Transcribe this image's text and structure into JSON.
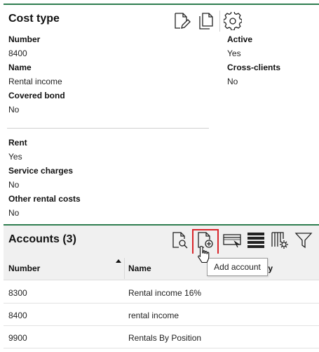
{
  "cost_type": {
    "title": "Cost type",
    "fields": [
      {
        "label": "Number",
        "value": "8400"
      },
      {
        "label": "Name",
        "value": "Rental income"
      },
      {
        "label": "Covered bond",
        "value": "No"
      },
      {
        "label": "Active",
        "value": "Yes"
      },
      {
        "label": "Cross-clients",
        "value": "No"
      },
      {
        "label": "Rent",
        "value": "Yes"
      },
      {
        "label": "Service charges",
        "value": "No"
      },
      {
        "label": "Other rental costs",
        "value": "No"
      }
    ],
    "toolbar_icons": [
      "edit-document-icon",
      "copy-document-icon",
      "settings-gear-icon"
    ]
  },
  "accounts": {
    "title": "Accounts (3)",
    "toolbar_icons": [
      "view-document-icon",
      "add-account-icon",
      "card-icon",
      "table-rows-icon",
      "column-settings-icon",
      "filter-icon"
    ],
    "columns": [
      "Number",
      "Name",
      "ity"
    ],
    "sort_column": "Number",
    "sort_direction": "ascending",
    "rows": [
      {
        "number": "8300",
        "name": "Rental income 16%"
      },
      {
        "number": "8400",
        "name": "rental income"
      },
      {
        "number": "9900",
        "name": "Rentals By Position"
      }
    ],
    "tooltip": "Add account"
  },
  "colors": {
    "accent_green": "#2e7d4f",
    "highlight_red": "#d9262b",
    "header_gray": "#f0f0f0"
  }
}
